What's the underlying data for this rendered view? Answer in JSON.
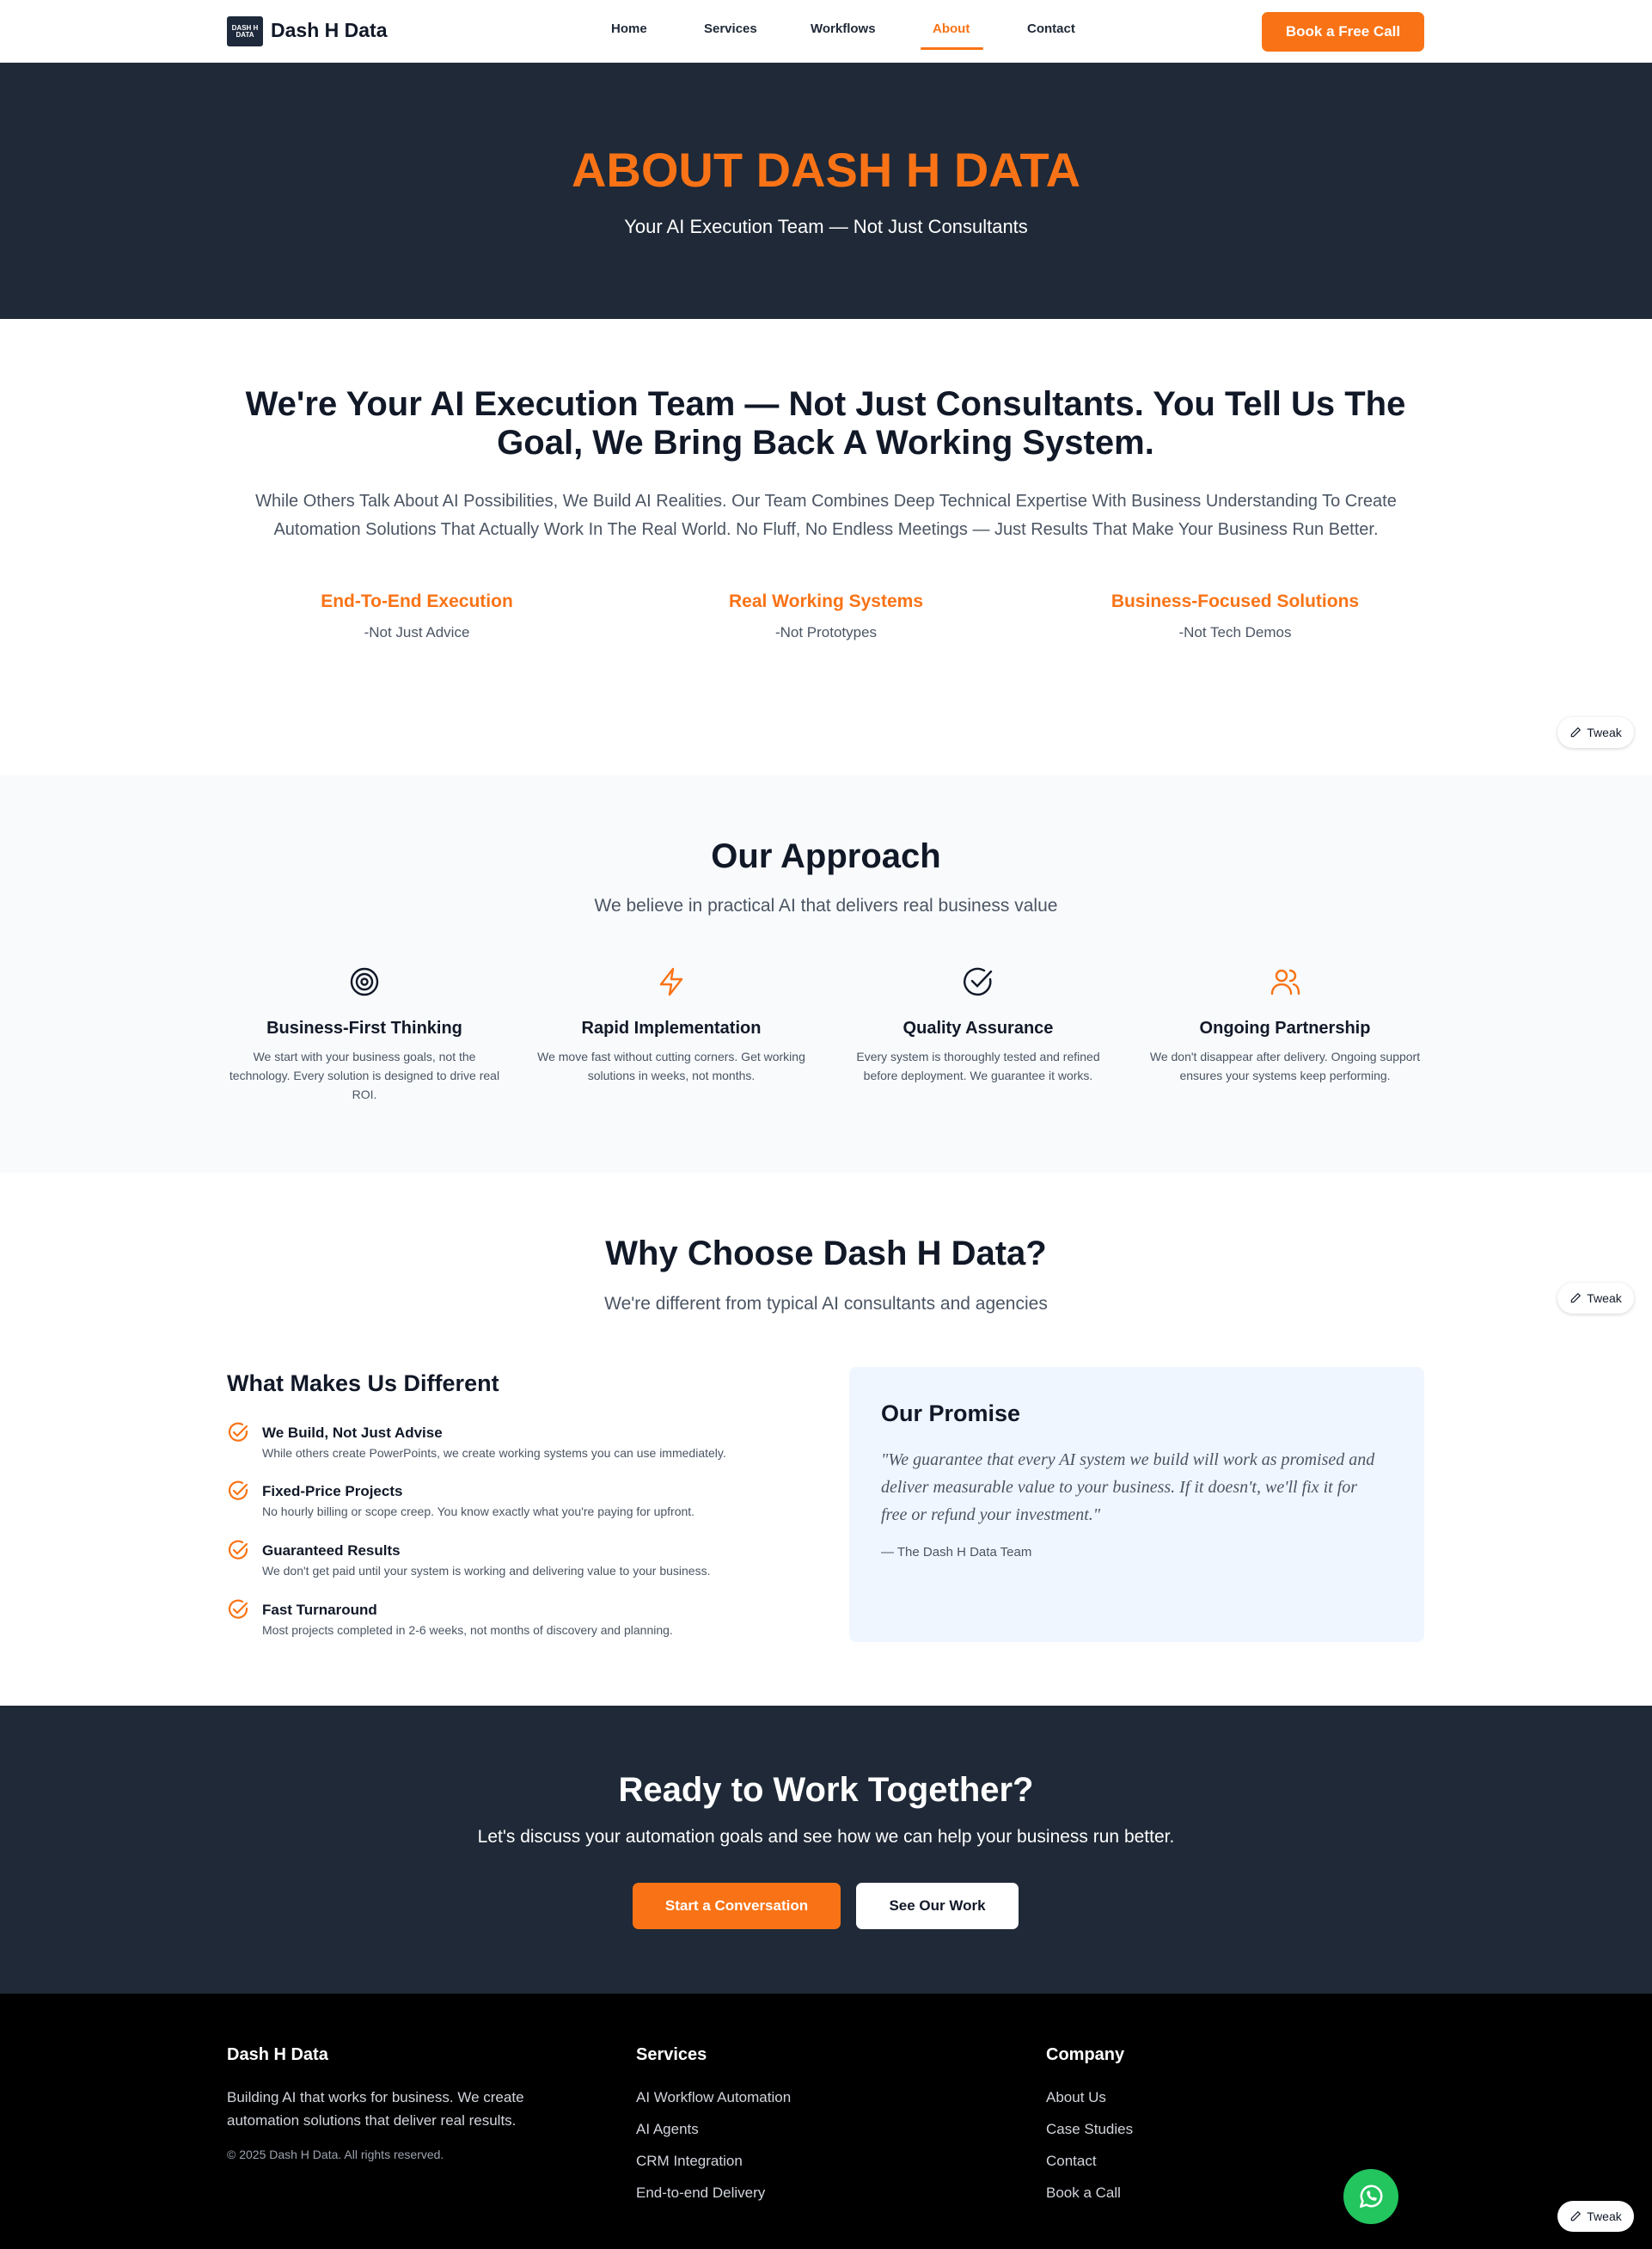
{
  "header": {
    "logo_text": "DASH H DATA",
    "brand": "Dash H Data",
    "nav": [
      {
        "label": "Home"
      },
      {
        "label": "Services"
      },
      {
        "label": "Workflows"
      },
      {
        "label": "About"
      },
      {
        "label": "Contact"
      }
    ],
    "active_nav": "About",
    "cta_label": "Book a Free Call"
  },
  "hero": {
    "title": "ABOUT DASH H DATA",
    "subtitle": "Your AI Execution Team — Not Just Consultants"
  },
  "intro": {
    "title": "We're Your AI Execution Team — Not Just Consultants. You Tell Us The Goal, We Bring Back A Working System.",
    "text": "While Others Talk About AI Possibilities, We Build AI Realities. Our Team Combines Deep Technical Expertise With Business Understanding To Create Automation Solutions That Actually Work In The Real World. No Fluff, No Endless Meetings — Just Results That Make Your Business Run Better.",
    "pillars": [
      {
        "title": "End-To-End Execution",
        "sub": "-Not Just Advice"
      },
      {
        "title": "Real Working Systems",
        "sub": "-Not Prototypes"
      },
      {
        "title": "Business-Focused Solutions",
        "sub": "-Not Tech Demos"
      }
    ]
  },
  "tweak_label": "Tweak",
  "approach": {
    "title": "Our Approach",
    "subtitle": "We believe in practical AI that delivers real business value",
    "cards": [
      {
        "icon": "target-icon",
        "title": "Business-First Thinking",
        "desc": "We start with your business goals, not the technology. Every solution is designed to drive real ROI."
      },
      {
        "icon": "lightning-icon",
        "title": "Rapid Implementation",
        "desc": "We move fast without cutting corners. Get working solutions in weeks, not months."
      },
      {
        "icon": "check-circle-icon",
        "title": "Quality Assurance",
        "desc": "Every system is thoroughly tested and refined before deployment. We guarantee it works."
      },
      {
        "icon": "users-icon",
        "title": "Ongoing Partnership",
        "desc": "We don't disappear after delivery. Ongoing support ensures your systems keep performing."
      }
    ]
  },
  "why": {
    "title": "Why Choose Dash H Data?",
    "subtitle": "We're different from typical AI consultants and agencies",
    "diff_title": "What Makes Us Different",
    "items": [
      {
        "title": "We Build, Not Just Advise",
        "desc": "While others create PowerPoints, we create working systems you can use immediately."
      },
      {
        "title": "Fixed-Price Projects",
        "desc": "No hourly billing or scope creep. You know exactly what you're paying for upfront."
      },
      {
        "title": "Guaranteed Results",
        "desc": "We don't get paid until your system is working and delivering value to your business."
      },
      {
        "title": "Fast Turnaround",
        "desc": "Most projects completed in 2-6 weeks, not months of discovery and planning."
      }
    ],
    "promise": {
      "title": "Our Promise",
      "quote": "\"We guarantee that every AI system we build will work as promised and deliver measurable value to your business. If it doesn't, we'll fix it for free or refund your investment.\"",
      "signature": "— The Dash H Data Team"
    }
  },
  "cta": {
    "title": "Ready to Work Together?",
    "subtitle": "Let's discuss your automation goals and see how we can help your business run better.",
    "primary": "Start a Conversation",
    "secondary": "See Our Work"
  },
  "footer": {
    "brand": "Dash H Data",
    "desc": "Building AI that works for business. We create automation solutions that deliver real results.",
    "copyright": "© 2025 Dash H Data. All rights reserved.",
    "services_title": "Services",
    "services": [
      "AI Workflow Automation",
      "AI Agents",
      "CRM Integration",
      "End-to-end Delivery"
    ],
    "company_title": "Company",
    "company": [
      "About Us",
      "Case Studies",
      "Contact",
      "Book a Call"
    ]
  },
  "colors": {
    "accent": "#f97316",
    "dark": "#1f2937",
    "footer": "#000000",
    "whatsapp": "#22c55e"
  }
}
